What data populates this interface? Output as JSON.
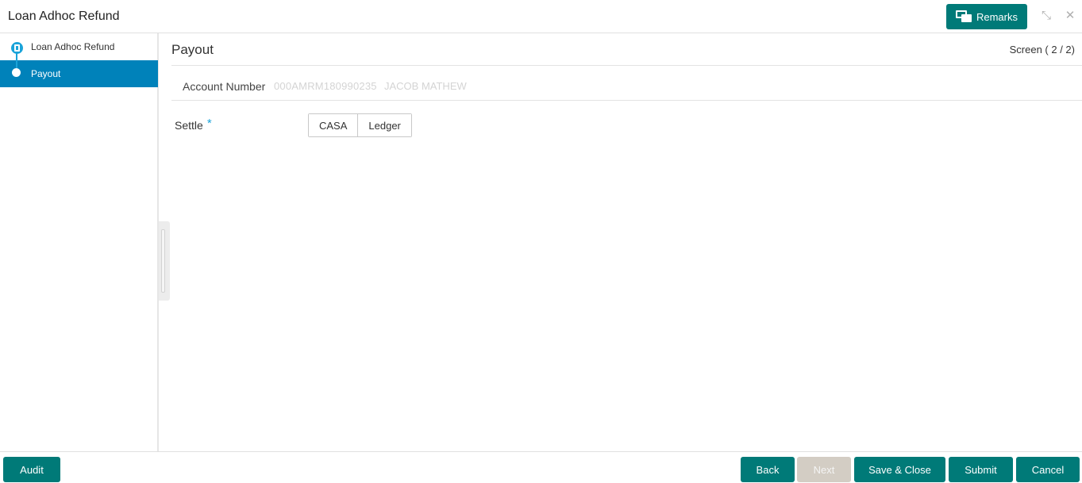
{
  "header": {
    "title": "Loan Adhoc Refund",
    "remarks_label": "Remarks",
    "minimize_glyph": "⤡",
    "close_glyph": "✕"
  },
  "sidebar": {
    "steps": [
      {
        "label": "Loan Adhoc Refund",
        "state": "completed"
      },
      {
        "label": "Payout",
        "state": "active"
      }
    ]
  },
  "main": {
    "title": "Payout",
    "screen_counter": "Screen ( 2 / 2)",
    "account": {
      "label": "Account Number",
      "value": "000AMRM180990235",
      "name": "JACOB MATHEW"
    },
    "settle": {
      "label": "Settle",
      "required_mark": "*",
      "options": [
        "CASA",
        "Ledger"
      ]
    }
  },
  "footer": {
    "audit": "Audit",
    "back": "Back",
    "next": "Next",
    "save_close": "Save & Close",
    "submit": "Submit",
    "cancel": "Cancel"
  },
  "colors": {
    "primary": "#007a78",
    "active_step": "#0082ba",
    "step_accent": "#1aa3d9",
    "disabled": "#d3cdc4"
  },
  "icons": {
    "remarks": "speech-bubbles-icon",
    "minimize": "minimize-icon",
    "close": "close-icon"
  }
}
